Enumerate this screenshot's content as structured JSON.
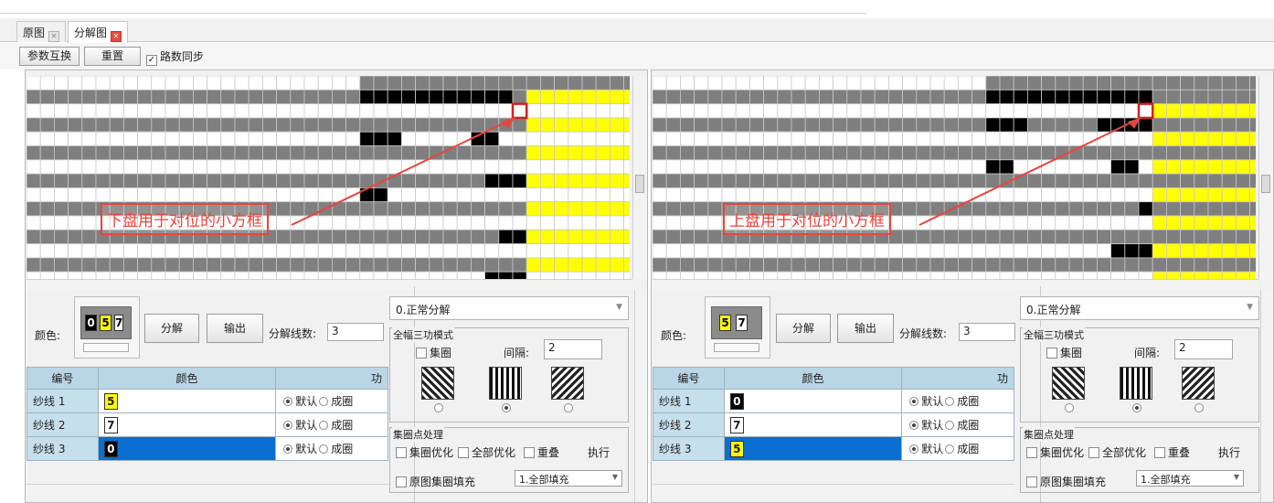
{
  "tabs": [
    {
      "label": "原图",
      "active": false
    },
    {
      "label": "分解图",
      "active": true
    }
  ],
  "toolbar": {
    "swap_label": "参数互换",
    "reset_label": "重置",
    "sync_label": "路数同步",
    "sync_checked": true
  },
  "colors": {
    "yellow": "#ffff00",
    "gray": "#7f7f7f",
    "black": "#000000",
    "white": "#ffffff",
    "grid_line": "#c8c8c8",
    "highlight": "#e8453c",
    "selected_row": "#0a6fd0",
    "header": "#b9d6e6"
  },
  "panels": [
    {
      "id": "left",
      "callout": "下盘用于对位的小方框",
      "color_label": "颜色:",
      "swatches": [
        "0",
        "5",
        "7"
      ],
      "decompose_label": "分解",
      "output_label": "输出",
      "line_count_label": "分解线数:",
      "line_count_value": "3",
      "table_headers": [
        "编号",
        "颜色",
        "功"
      ],
      "rows": [
        {
          "name": "纱线 1",
          "chip": "5",
          "default": "默认",
          "tuck": "成圈",
          "selected": false
        },
        {
          "name": "纱线 2",
          "chip": "7",
          "default": "默认",
          "tuck": "成圈",
          "selected": false
        },
        {
          "name": "纱线 3",
          "chip": "0",
          "default": "默认",
          "tuck": "成圈",
          "selected": true
        }
      ],
      "mode": "0.正常分解",
      "three_mode_title": "全幅三功模式",
      "tuck_label": "集圈",
      "interval_label": "间隔:",
      "interval_value": "2",
      "tuck_point_title": "集圈点处理",
      "tuck_opt": "集圈优化",
      "all_opt": "全部优化",
      "overlap": "重叠",
      "execute": "执行",
      "fill_label": "原图集圈填充",
      "fill_value": "1.全部填充"
    },
    {
      "id": "right",
      "callout": "上盘用于对位的小方框",
      "color_label": "颜色:",
      "swatches": [
        "5",
        "7"
      ],
      "decompose_label": "分解",
      "output_label": "输出",
      "line_count_label": "分解线数:",
      "line_count_value": "3",
      "table_headers": [
        "编号",
        "颜色",
        "功"
      ],
      "rows": [
        {
          "name": "纱线 1",
          "chip": "0",
          "default": "默认",
          "tuck": "成圈",
          "selected": false
        },
        {
          "name": "纱线 2",
          "chip": "7",
          "default": "默认",
          "tuck": "成圈",
          "selected": false
        },
        {
          "name": "纱线 3",
          "chip": "5",
          "default": "默认",
          "tuck": "成圈",
          "selected": true
        }
      ],
      "mode": "0.正常分解",
      "three_mode_title": "全幅三功模式",
      "tuck_label": "集圈",
      "interval_label": "间隔:",
      "interval_value": "2",
      "tuck_point_title": "集圈点处理",
      "tuck_opt": "集圈优化",
      "all_opt": "全部优化",
      "overlap": "重叠",
      "execute": "执行",
      "fill_label": "原图集圈填充",
      "fill_value": "1.全部填充"
    }
  ]
}
